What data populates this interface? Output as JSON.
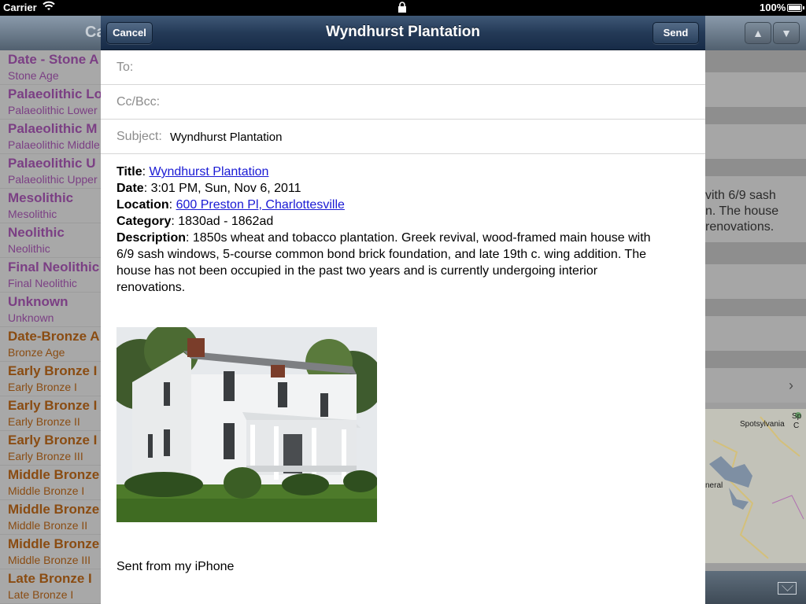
{
  "status_bar": {
    "carrier": "Carrier",
    "battery_percent": "100%"
  },
  "background_app": {
    "nav_title_partial": "Ca",
    "up_arrow": "▲",
    "down_arrow": "▼",
    "list_items": [
      {
        "title": "Date - Stone A",
        "subtitle": "Stone Age",
        "group": "stone"
      },
      {
        "title": "Palaeolithic Lo",
        "subtitle": "Palaeolithic Lower",
        "group": "stone"
      },
      {
        "title": "Palaeolithic M",
        "subtitle": "Palaeolithic Middle",
        "group": "stone"
      },
      {
        "title": "Palaeolithic U",
        "subtitle": "Palaeolithic Upper",
        "group": "stone"
      },
      {
        "title": "Mesolithic",
        "subtitle": "Mesolithic",
        "group": "stone"
      },
      {
        "title": "Neolithic",
        "subtitle": "Neolithic",
        "group": "stone"
      },
      {
        "title": "Final Neolithic",
        "subtitle": "Final Neolithic",
        "group": "stone"
      },
      {
        "title": "Unknown",
        "subtitle": "Unknown",
        "group": "stone"
      },
      {
        "title": "Date-Bronze A",
        "subtitle": "Bronze Age",
        "group": "bronze"
      },
      {
        "title": "Early Bronze I",
        "subtitle": "Early Bronze I",
        "group": "bronze"
      },
      {
        "title": "Early Bronze I",
        "subtitle": "Early Bronze II",
        "group": "bronze"
      },
      {
        "title": "Early Bronze I",
        "subtitle": "Early Bronze III",
        "group": "bronze"
      },
      {
        "title": "Middle Bronze",
        "subtitle": "Middle Bronze I",
        "group": "bronze"
      },
      {
        "title": "Middle Bronze",
        "subtitle": "Middle Bronze II",
        "group": "bronze"
      },
      {
        "title": "Middle Bronze",
        "subtitle": "Middle Bronze III",
        "group": "bronze"
      },
      {
        "title": "Late Bronze I",
        "subtitle": "Late Bronze I",
        "group": "bronze"
      }
    ],
    "detail_text_lines": [
      "vith 6/9 sash",
      "n.  The house",
      "renovations."
    ],
    "map_labels": {
      "county": "Spotsylvania",
      "edge": "Sp",
      "edge2": "C",
      "lake": "neral"
    }
  },
  "compose": {
    "title": "Wyndhurst Plantation",
    "cancel_label": "Cancel",
    "send_label": "Send",
    "to_label": "To:",
    "to_value": "",
    "ccbcc_label": "Cc/Bcc:",
    "ccbcc_value": "",
    "subject_label": "Subject:",
    "subject_value": "Wyndhurst Plantation",
    "body": {
      "title_label": "Title",
      "title_value": "Wyndhurst Plantation",
      "date_label": "Date",
      "date_value": "3:01 PM, Sun, Nov 6, 2011",
      "location_label": "Location",
      "location_value": "600 Preston Pl, Charlottesville",
      "category_label": "Category",
      "category_value": "1830ad - 1862ad",
      "description_label": "Description",
      "description_lines": [
        ": 1850s wheat and tobacco plantation. Greek revival, wood-framed main house with",
        "6/9 sash windows, 5-course common bond brick foundation, and late 19th c. wing addition. The",
        "house has not been occupied in the past two years and is currently undergoing interior",
        "renovations."
      ]
    },
    "signature": "Sent from my iPhone"
  },
  "colors": {
    "nav_dark": "#243a57",
    "link": "#1a1ad4",
    "stone_age_purple": "#7b3f84",
    "bronze_age_orange": "#8a4c12"
  }
}
